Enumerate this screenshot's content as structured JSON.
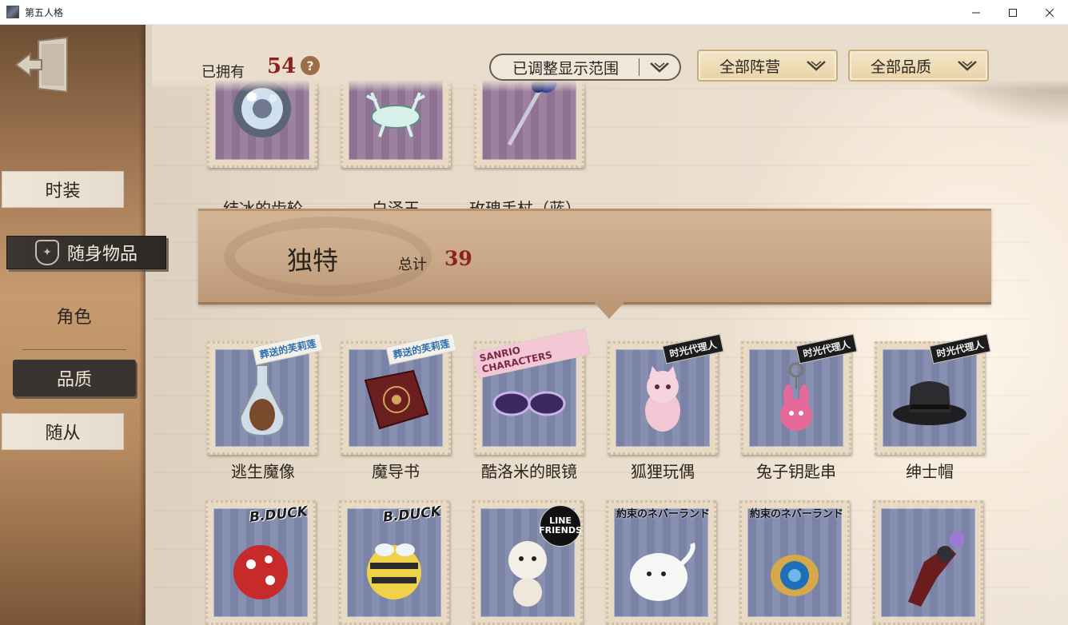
{
  "window": {
    "title": "第五人格",
    "controls": {
      "minimize": "—",
      "maximize": "☐",
      "close": "✕"
    }
  },
  "sidebar": {
    "items": [
      {
        "label": "时装",
        "state": "paper"
      },
      {
        "label": "随身物品",
        "state": "selected"
      },
      {
        "label": "角色",
        "state": "plain"
      },
      {
        "label": "品质",
        "state": "dark"
      },
      {
        "label": "随从",
        "state": "paper"
      }
    ]
  },
  "header": {
    "owned_label": "已拥有",
    "owned_count": "54",
    "help_icon": "?",
    "filters": {
      "range": "已调整显示范围",
      "camp": "全部阵营",
      "quality": "全部品质"
    }
  },
  "section": {
    "title": "独特",
    "total_label": "总计",
    "total": "39"
  },
  "items_row1": [
    {
      "name": "结冰的齿轮",
      "icon": "frozen-gear-icon",
      "color": "purple"
    },
    {
      "name": "白泽玉",
      "icon": "jade-deer-icon",
      "color": "purple"
    },
    {
      "name": "玫瑰手杖（蓝）",
      "icon": "rose-cane-icon",
      "color": "purple"
    }
  ],
  "items_row2": [
    {
      "name": "逃生魔像",
      "icon": "bottled-golem-icon",
      "tag": "葬送的芙莉莲",
      "color": "blue"
    },
    {
      "name": "魔导书",
      "icon": "grimoire-icon",
      "tag": "葬送的芙莉莲",
      "color": "blue"
    },
    {
      "name": "酷洛米的眼镜",
      "icon": "kuromi-glasses-icon",
      "tag": "SANRIO CHARACTERS",
      "color": "blue"
    },
    {
      "name": "狐狸玩偶",
      "icon": "fox-doll-icon",
      "tag": "时光代理人",
      "color": "blue"
    },
    {
      "name": "兔子钥匙串",
      "icon": "bunny-keychain-icon",
      "tag": "时光代理人",
      "color": "blue"
    },
    {
      "name": "绅士帽",
      "icon": "top-hat-icon",
      "tag": "时光代理人",
      "color": "blue"
    }
  ],
  "items_row3": [
    {
      "icon": "ladybug-duck-icon",
      "tag": "B.DUCK",
      "color": "blue"
    },
    {
      "icon": "bee-duck-icon",
      "tag": "B.DUCK",
      "color": "blue"
    },
    {
      "icon": "line-friends-doll-icon",
      "tag": "LINE FRIENDS",
      "color": "blue"
    },
    {
      "icon": "ghost-plush-icon",
      "tag": "約束のネバーランド",
      "color": "blue"
    },
    {
      "icon": "pocket-watch-icon",
      "tag": "約束のネバーランド",
      "color": "blue"
    },
    {
      "icon": "crimson-relic-icon",
      "tag": "",
      "color": "blue"
    }
  ],
  "colors": {
    "accent_red": "#8f2020",
    "paper": "#e9ddcd",
    "wood": "#b78b61",
    "stamp_purple": "#8e7292",
    "stamp_blue": "#7a82a6"
  }
}
